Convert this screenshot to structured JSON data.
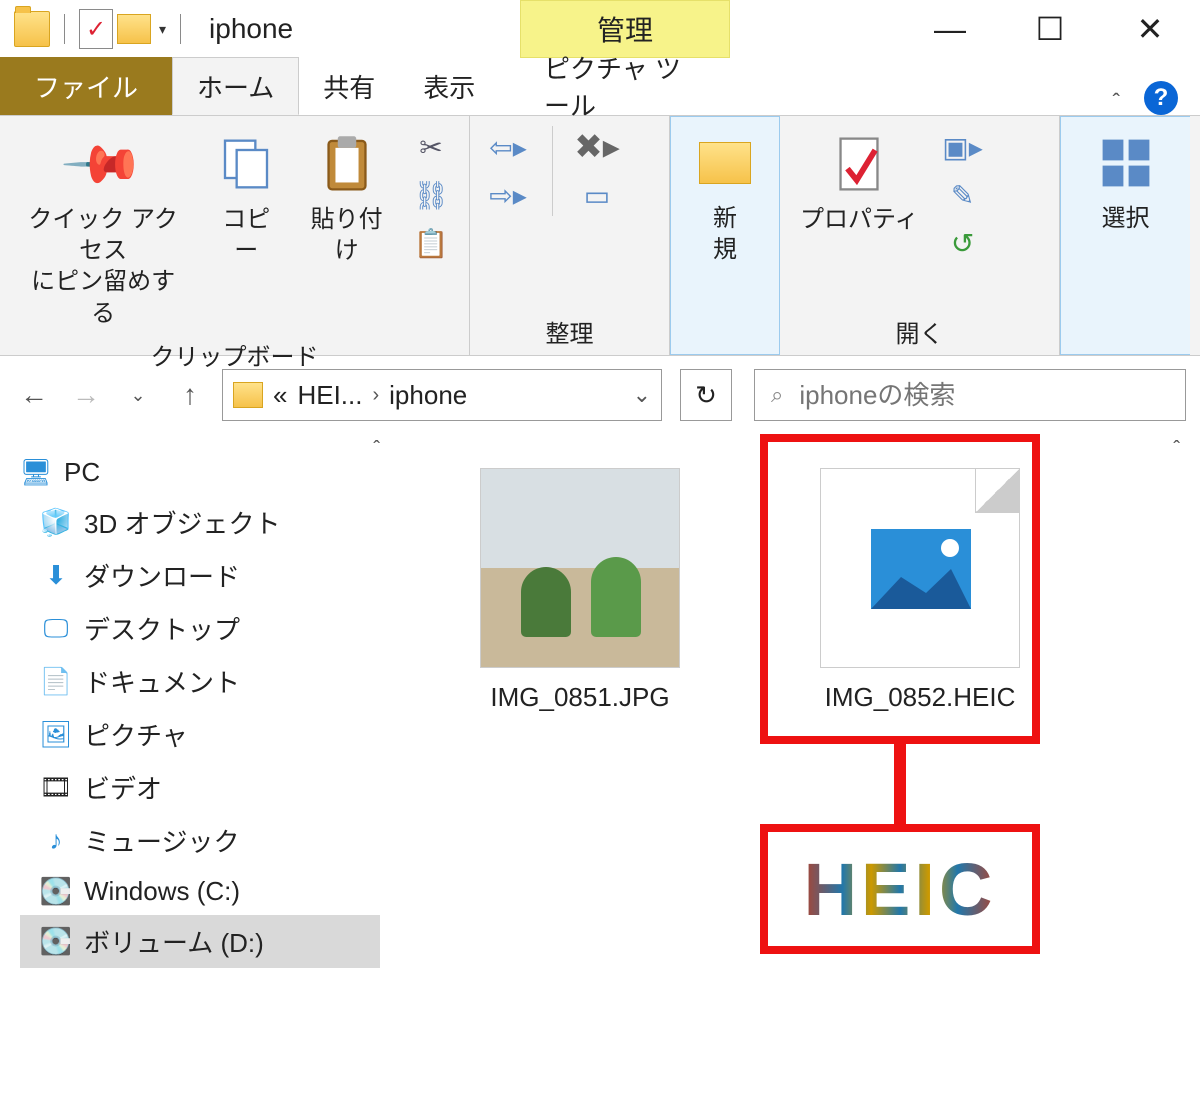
{
  "window": {
    "title": "iphone",
    "context_tab_header": "管理",
    "context_tab": "ピクチャ ツール"
  },
  "tabs": {
    "file": "ファイル",
    "home": "ホーム",
    "share": "共有",
    "view": "表示"
  },
  "ribbon": {
    "pin": "クイック アクセス\nにピン留めする",
    "copy": "コピー",
    "paste": "貼り付け",
    "group_clipboard": "クリップボード",
    "group_organize": "整理",
    "new": "新\n規",
    "properties": "プロパティ",
    "group_open": "開く",
    "select": "選択"
  },
  "nav": {
    "breadcrumb_parent": "HEI...",
    "breadcrumb_current": "iphone",
    "search_placeholder": "iphoneの検索"
  },
  "tree": {
    "pc": "PC",
    "items": [
      "3D オブジェクト",
      "ダウンロード",
      "デスクトップ",
      "ドキュメント",
      "ピクチャ",
      "ビデオ",
      "ミュージック",
      "Windows (C:)",
      "ボリューム (D:)"
    ]
  },
  "files": [
    {
      "name": "IMG_0851.JPG",
      "kind": "photo"
    },
    {
      "name": "IMG_0852.HEIC",
      "kind": "generic"
    }
  ],
  "callout": {
    "label": "HEIC"
  }
}
